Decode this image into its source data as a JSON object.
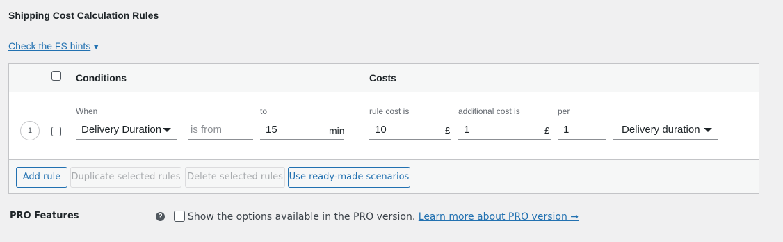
{
  "section": {
    "title": "Shipping Cost Calculation Rules",
    "hints_link": "Check the FS hints",
    "hints_arrow": "▼"
  },
  "table": {
    "headers": {
      "conditions": "Conditions",
      "costs": "Costs"
    },
    "rows": [
      {
        "number": "1",
        "when_label": "When",
        "condition_select": "Delivery Duration",
        "operator": "is from",
        "to_label": "to",
        "to_value": "15",
        "unit": "min",
        "rule_cost_label": "rule cost is",
        "rule_cost_value": "10",
        "rule_cost_currency": "£",
        "additional_cost_label": "additional cost is",
        "additional_cost_value": "1",
        "additional_cost_currency": "£",
        "per_label": "per",
        "per_value": "1",
        "per_select": "Delivery duration"
      }
    ],
    "footer_buttons": {
      "add_rule": "Add rule",
      "duplicate": "Duplicate selected rules",
      "delete": "Delete selected rules",
      "scenarios": "Use ready-made scenarios"
    }
  },
  "pro": {
    "title": "PRO Features",
    "help_icon": "?",
    "checkbox_label": "Show the options available in the PRO version.",
    "learn_more": "Learn more about PRO version →"
  },
  "colors": {
    "accent": "#2271b1",
    "background": "#f0f0f1",
    "border": "#c3c4c7"
  }
}
